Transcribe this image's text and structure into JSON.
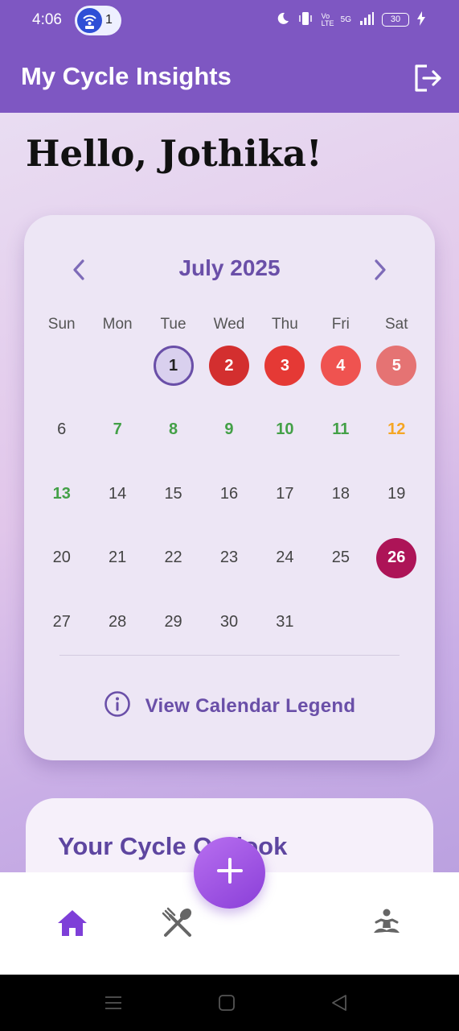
{
  "status_bar": {
    "time": "4:06",
    "hotspot_count": "1",
    "battery": "30",
    "network": "5G",
    "volte": "Vo LTE"
  },
  "app_bar": {
    "title": "My Cycle Insights",
    "logout_icon": "logout-icon"
  },
  "greeting": "Hello, Jothika!",
  "calendar": {
    "month_label": "July 2025",
    "prev_icon": "chevron-left-icon",
    "next_icon": "chevron-right-icon",
    "weekdays": [
      "Sun",
      "Mon",
      "Tue",
      "Wed",
      "Thu",
      "Fri",
      "Sat"
    ],
    "colors": {
      "today_ring": "#6a4fa8",
      "period_dark": "#d32f2f",
      "period_mid": "#e53935",
      "period_light": "#ef5350",
      "period_lighter": "#e57373",
      "fertile": "#43a047",
      "ovulation": "#f5a623",
      "highlight": "#ad1457"
    },
    "days": [
      {
        "label": "",
        "style": "empty"
      },
      {
        "label": "",
        "style": "empty"
      },
      {
        "label": "1",
        "style": "today"
      },
      {
        "label": "2",
        "style": "filled",
        "color": "#d32f2f"
      },
      {
        "label": "3",
        "style": "filled",
        "color": "#e53935"
      },
      {
        "label": "4",
        "style": "filled",
        "color": "#ef5350"
      },
      {
        "label": "5",
        "style": "filled",
        "color": "#e57373"
      },
      {
        "label": "6",
        "style": "plain"
      },
      {
        "label": "7",
        "style": "text",
        "color": "#43a047"
      },
      {
        "label": "8",
        "style": "text",
        "color": "#43a047"
      },
      {
        "label": "9",
        "style": "text",
        "color": "#43a047"
      },
      {
        "label": "10",
        "style": "text",
        "color": "#43a047"
      },
      {
        "label": "11",
        "style": "text",
        "color": "#43a047"
      },
      {
        "label": "12",
        "style": "text",
        "color": "#f5a623"
      },
      {
        "label": "13",
        "style": "text",
        "color": "#43a047"
      },
      {
        "label": "14",
        "style": "plain"
      },
      {
        "label": "15",
        "style": "plain"
      },
      {
        "label": "16",
        "style": "plain"
      },
      {
        "label": "17",
        "style": "plain"
      },
      {
        "label": "18",
        "style": "plain"
      },
      {
        "label": "19",
        "style": "plain"
      },
      {
        "label": "20",
        "style": "plain"
      },
      {
        "label": "21",
        "style": "plain"
      },
      {
        "label": "22",
        "style": "plain"
      },
      {
        "label": "23",
        "style": "plain"
      },
      {
        "label": "24",
        "style": "plain"
      },
      {
        "label": "25",
        "style": "plain"
      },
      {
        "label": "26",
        "style": "filled",
        "color": "#ad1457"
      },
      {
        "label": "27",
        "style": "plain"
      },
      {
        "label": "28",
        "style": "plain"
      },
      {
        "label": "29",
        "style": "plain"
      },
      {
        "label": "30",
        "style": "plain"
      },
      {
        "label": "31",
        "style": "plain"
      }
    ],
    "legend_link": "View Calendar Legend",
    "legend_icon": "info-icon"
  },
  "outlook": {
    "title": "Your Cycle Outlook"
  },
  "bottom_nav": {
    "items": [
      {
        "name": "home",
        "icon": "home-icon",
        "active": true
      },
      {
        "name": "nutrition",
        "icon": "utensils-icon",
        "active": false
      },
      {
        "name": "wellness",
        "icon": "meditation-icon",
        "active": false
      }
    ],
    "fab_icon": "plus-icon",
    "active_color": "#7e3fd8",
    "inactive_color": "#666666"
  }
}
